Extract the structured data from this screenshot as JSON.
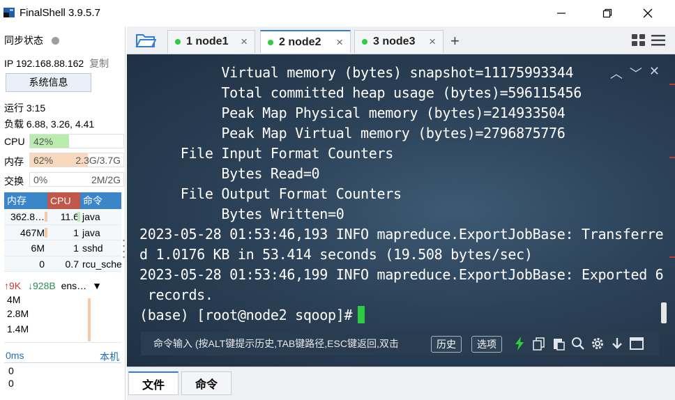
{
  "window": {
    "title": "FinalShell 3.9.5.7"
  },
  "sidebar": {
    "sync_label": "同步状态",
    "ip_label": "IP 192.168.88.162",
    "copy_label": "复制",
    "sysinfo_button": "系统信息",
    "uptime": "运行 3:15",
    "load": "负载 6.88, 3.26, 4.41",
    "cpu": {
      "label": "CPU",
      "percent_text": "42%",
      "fraction": 0.42,
      "color": "#b9ecae"
    },
    "mem": {
      "label": "内存",
      "percent_text": "62%",
      "amount": "2.3G/3.7G",
      "fraction": 0.62,
      "color": "#f9d9be"
    },
    "swap": {
      "label": "交换",
      "percent_text": "0%",
      "amount": "2M/2G",
      "fraction": 0.0,
      "color": "#f9d9be"
    },
    "process_table": {
      "headers": [
        "内存",
        "CPU",
        "命令"
      ],
      "header_colors": [
        "#3b86c8",
        "#c0574a",
        "#3b86c8"
      ],
      "rows": [
        {
          "mem": "362.8…",
          "cpu": "11.6",
          "cmd": "java"
        },
        {
          "mem": "467M",
          "cpu": "1",
          "cmd": "java"
        },
        {
          "mem": "6M",
          "cpu": "1",
          "cmd": "sshd"
        },
        {
          "mem": "0",
          "cpu": "0.7",
          "cmd": "rcu_sche"
        }
      ]
    },
    "network": {
      "up": "9K",
      "down": "928B",
      "iface": "ens…",
      "scale_labels": [
        "4M",
        "2.8M",
        "1.4M"
      ]
    },
    "latency": {
      "ms_label": "0ms",
      "host_label": "本机",
      "values": [
        "0",
        "0"
      ]
    }
  },
  "tabs": [
    {
      "label": "1 node1",
      "active": false
    },
    {
      "label": "2 node2",
      "active": true
    },
    {
      "label": "3 node3",
      "active": false
    }
  ],
  "terminal": {
    "lines": [
      "          Virtual memory (bytes) snapshot=11175993344",
      "          Total committed heap usage (bytes)=596115456",
      "          Peak Map Physical memory (bytes)=214933504",
      "          Peak Map Virtual memory (bytes)=2796875776",
      "     File Input Format Counters",
      "          Bytes Read=0",
      "     File Output Format Counters",
      "          Bytes Written=0",
      "2023-05-28 01:53:46,193 INFO mapreduce.ExportJobBase: Transferre",
      "d 1.0176 KB in 53.414 seconds (19.508 bytes/sec)",
      "2023-05-28 01:53:46,199 INFO mapreduce.ExportJobBase: Exported 6",
      " records."
    ],
    "prompt": "(base) [root@node2 sqoop]#",
    "accent": "#2ecc40"
  },
  "command_bar": {
    "placeholder": "命令输入 (按ALT键提示历史,TAB键路径,ESC键返回,双击",
    "history_button": "历史",
    "options_button": "选项"
  },
  "bottom_tabs": [
    {
      "label": "文件",
      "active": true
    },
    {
      "label": "命令",
      "active": false
    }
  ]
}
